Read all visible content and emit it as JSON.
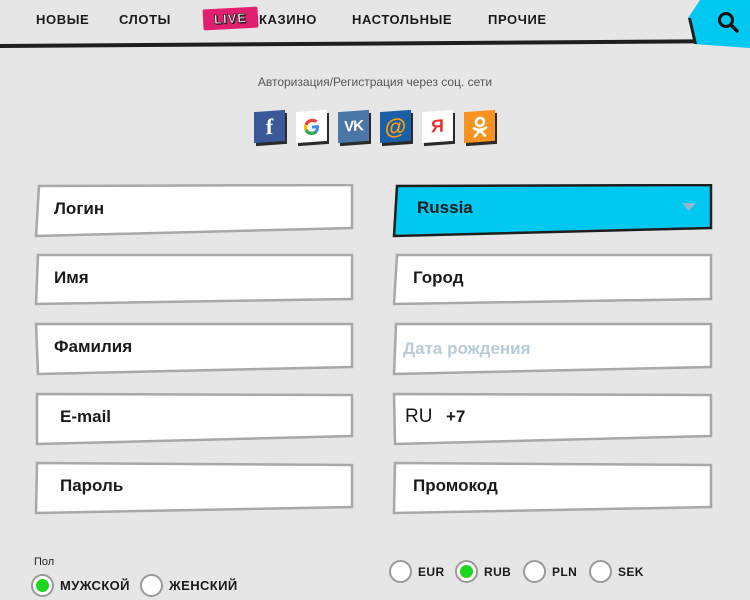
{
  "nav": {
    "items": [
      "НОВЫЕ",
      "СЛОТЫ",
      "КАЗИНО",
      "НАСТОЛЬНЫЕ",
      "ПРОЧИЕ"
    ],
    "live_badge": "LIVE",
    "accent": "#00c8f0",
    "live_color": "#e0206e"
  },
  "social": {
    "title": "Авторизация/Регистрация через соц. сети",
    "icons": [
      {
        "name": "facebook-icon",
        "glyph": "f",
        "bg": "#3b5998"
      },
      {
        "name": "google-icon",
        "glyph": "G",
        "bg": "#ffffff"
      },
      {
        "name": "vk-icon",
        "glyph": "VK",
        "bg": "#4a76a8"
      },
      {
        "name": "mailru-icon",
        "glyph": "@",
        "bg": "#1a5fa8"
      },
      {
        "name": "yandex-icon",
        "glyph": "Я",
        "bg": "#ffffff"
      },
      {
        "name": "odnoklassniki-icon",
        "glyph": "ok",
        "bg": "#f7931e"
      }
    ]
  },
  "form": {
    "login": "Логин",
    "name": "Имя",
    "surname": "Фамилия",
    "email": "E-mail",
    "password": "Пароль",
    "country": "Russia",
    "city": "Город",
    "birthdate_placeholder": "Дата рождения",
    "phone_country": "RU",
    "phone_code": "+7",
    "promo": "Промокод"
  },
  "gender": {
    "label": "Пол",
    "options": [
      "МУЖСКОЙ",
      "ЖЕНСКИЙ"
    ],
    "selected": "МУЖСКОЙ"
  },
  "currency": {
    "options": [
      "EUR",
      "RUB",
      "PLN",
      "SEK"
    ],
    "selected": "RUB"
  }
}
